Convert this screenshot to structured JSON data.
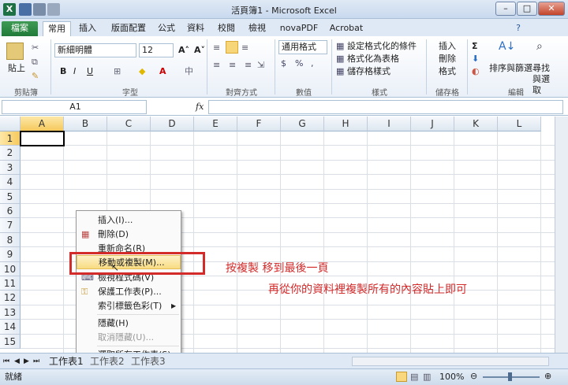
{
  "window": {
    "title": "活頁簿1 - Microsoft Excel"
  },
  "tabs": [
    "檔案",
    "常用",
    "插入",
    "版面配置",
    "公式",
    "資料",
    "校閱",
    "檢視",
    "novaPDF",
    "Acrobat"
  ],
  "ribbon": {
    "paste": "貼上",
    "font_name": "新細明體",
    "font_size": "12",
    "bold": "B",
    "italic": "I",
    "underline": "U",
    "number_format": "通用格式",
    "cond_format": "設定格式化的條件",
    "table_format": "格式化為表格",
    "cell_styles": "儲存格樣式",
    "insert": "插入",
    "delete": "刪除",
    "format": "格式",
    "sort_filter": "排序與篩選",
    "find_select": "尋找與選取",
    "groups": [
      "剪貼簿",
      "字型",
      "對齊方式",
      "數值",
      "樣式",
      "儲存格",
      "編輯"
    ]
  },
  "formula_bar": {
    "name_box": "A1",
    "fx": "fx"
  },
  "columns": [
    "A",
    "B",
    "C",
    "D",
    "E",
    "F",
    "G",
    "H",
    "I",
    "J",
    "K",
    "L"
  ],
  "rows": [
    "1",
    "2",
    "3",
    "4",
    "5",
    "6",
    "7",
    "8",
    "9",
    "10",
    "11",
    "12",
    "13",
    "14",
    "15"
  ],
  "context_menu": {
    "items": [
      {
        "label": "插入(I)..."
      },
      {
        "label": "刪除(D)"
      },
      {
        "label": "重新命名(R)"
      },
      {
        "label": "移動或複製(M)..."
      },
      {
        "label": "檢視程式碼(V)"
      },
      {
        "label": "保護工作表(P)..."
      },
      {
        "label": "索引標籤色彩(T)"
      },
      {
        "label": "隱藏(H)"
      },
      {
        "label": "取消隱藏(U)..."
      },
      {
        "label": "選取所有工作表(S)"
      }
    ]
  },
  "annotations": {
    "line1": "按複製 移到最後一頁",
    "line2": "再從你的資料裡複製所有的內容貼上即可"
  },
  "sheets": [
    "工作表1",
    "工作表2",
    "工作表3"
  ],
  "status": {
    "ready": "就緒",
    "zoom": "100%"
  }
}
